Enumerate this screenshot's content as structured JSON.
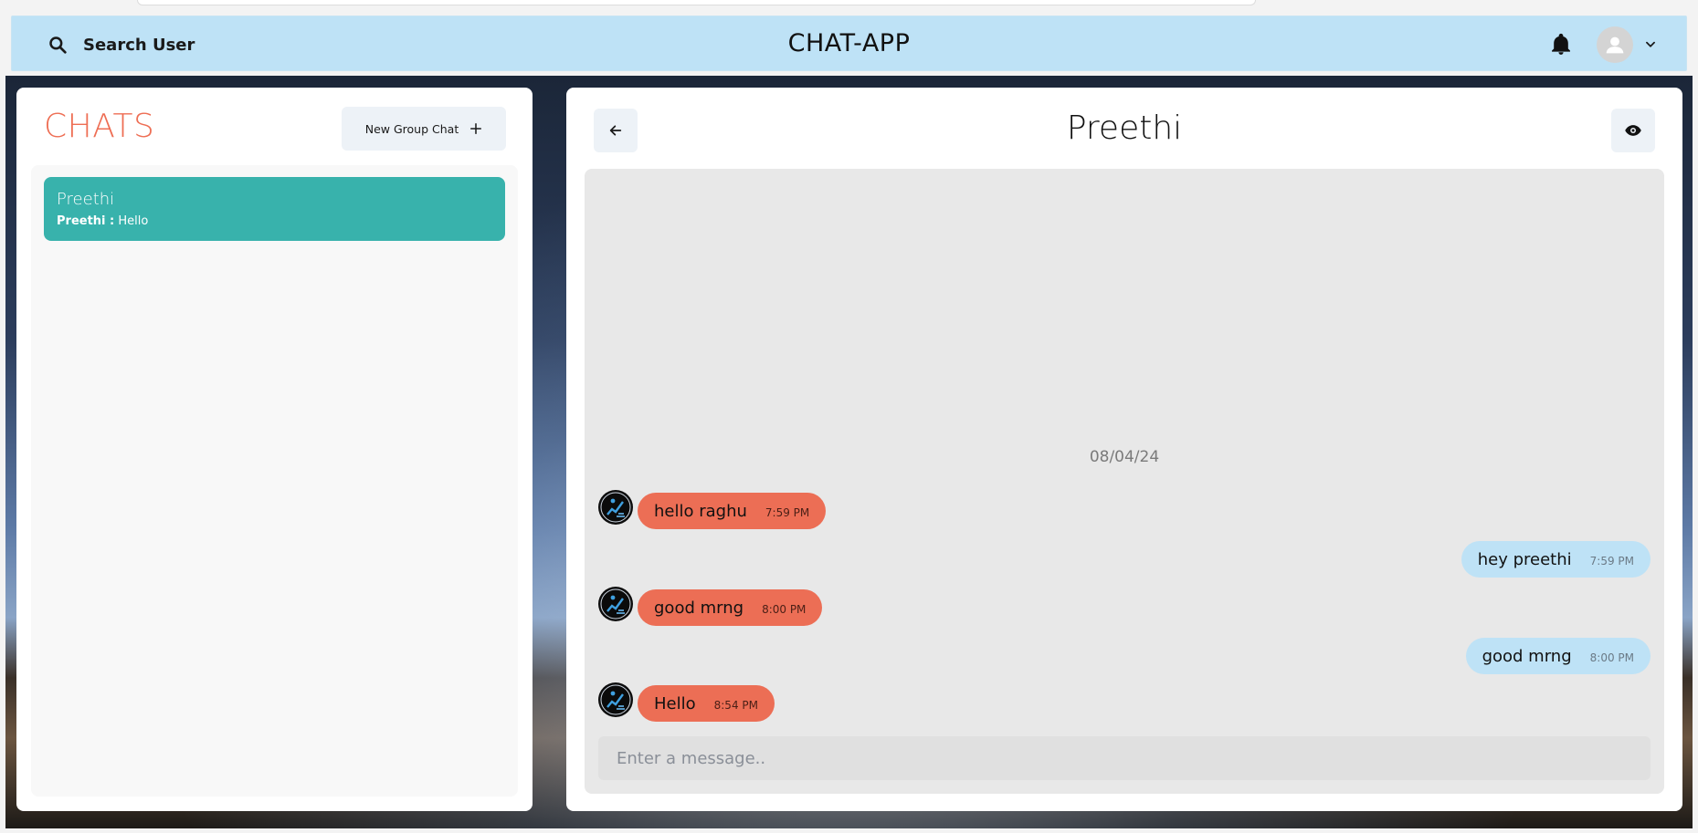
{
  "header": {
    "search_label": "Search User",
    "app_title": "CHAT-APP",
    "icons": {
      "search": "search-icon",
      "notifications": "bell-icon",
      "profile": "avatar-icon",
      "menu": "chevron-down-icon"
    }
  },
  "sidebar": {
    "title": "CHATS",
    "new_group_label": "New Group Chat",
    "chats": [
      {
        "name": "Preethi",
        "last_sender": "Preethi :",
        "last_message": "Hello",
        "selected": true
      }
    ]
  },
  "chat": {
    "title": "Preethi",
    "date_divider": "08/04/24",
    "messages": [
      {
        "direction": "in",
        "text": "hello raghu",
        "time": "7:59 PM"
      },
      {
        "direction": "out",
        "text": "hey preethi",
        "time": "7:59 PM"
      },
      {
        "direction": "in",
        "text": "good mrng",
        "time": "8:00 PM"
      },
      {
        "direction": "out",
        "text": "good mrng",
        "time": "8:00 PM"
      },
      {
        "direction": "in",
        "text": "Hello",
        "time": "8:54 PM"
      }
    ],
    "input_placeholder": "Enter a message.."
  },
  "colors": {
    "header_bg": "#bee2f6",
    "accent": "#ee6e54",
    "selected_chat": "#38b2ac",
    "incoming_bubble": "#ec6e55",
    "outgoing_bubble": "#bee2f6"
  }
}
